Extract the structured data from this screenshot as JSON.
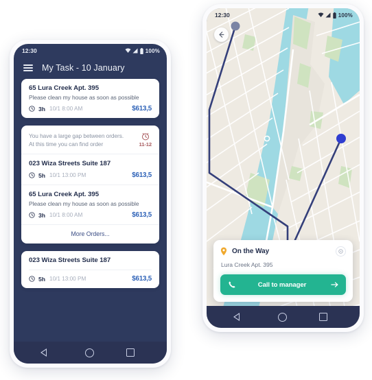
{
  "left_phone": {
    "status_bar": {
      "time": "12:30",
      "battery": "100%"
    },
    "app_bar": {
      "title": "My Task - 10 January",
      "menu_icon": "hamburger-menu-icon"
    },
    "cards": [
      {
        "type": "order_card",
        "orders": [
          {
            "title": "65 Lura Creek Apt. 395",
            "description": "Please clean my house as soon as possible",
            "duration": "3h",
            "when": "10/1 8:00 AM",
            "price": "$613,5"
          }
        ]
      },
      {
        "type": "gap_card",
        "gap_notice": {
          "line1": "You have a large gap between orders.",
          "line2": "At this time you can find order",
          "badge_time": "11-12",
          "badge_icon": "alarm-clock-icon"
        },
        "orders": [
          {
            "title": "023 Wiza Streets Suite 187",
            "description": "",
            "duration": "5h",
            "when": "10/1 13:00 PM",
            "price": "$613,5"
          },
          {
            "title": "65 Lura Creek Apt. 395",
            "description": "Please clean my house as soon as possible",
            "duration": "3h",
            "when": "10/1 8:00 AM",
            "price": "$613,5"
          }
        ],
        "more_label": "More Orders..."
      },
      {
        "type": "order_card",
        "orders": [
          {
            "title": "023 Wiza Streets Suite 187",
            "description": "",
            "duration": "5h",
            "when": "10/1 13:00 PM",
            "price": "$613,5"
          }
        ]
      }
    ],
    "nav_bar": {
      "back": "back-triangle",
      "home": "home-circle",
      "recents": "recents-square"
    }
  },
  "right_phone": {
    "status_bar": {
      "time": "12:30",
      "battery": "100%"
    },
    "map": {
      "back_button_icon": "back-arrow-icon",
      "origin_marker": "origin-pin-gray",
      "destination_marker": "destination-pin-blue",
      "route_color": "#343f7a"
    },
    "sheet": {
      "status_title": "On the Way",
      "status_icon": "location-pin-icon",
      "info_icon": "info-icon",
      "address": "Lura Creek Apt. 395",
      "call_button": {
        "label": "Call to manager",
        "icon": "phone-icon",
        "arrow": "arrow-right-icon",
        "color": "#23b491"
      }
    },
    "nav_bar": {
      "back": "back-triangle",
      "home": "home-circle",
      "recents": "recents-square"
    }
  }
}
